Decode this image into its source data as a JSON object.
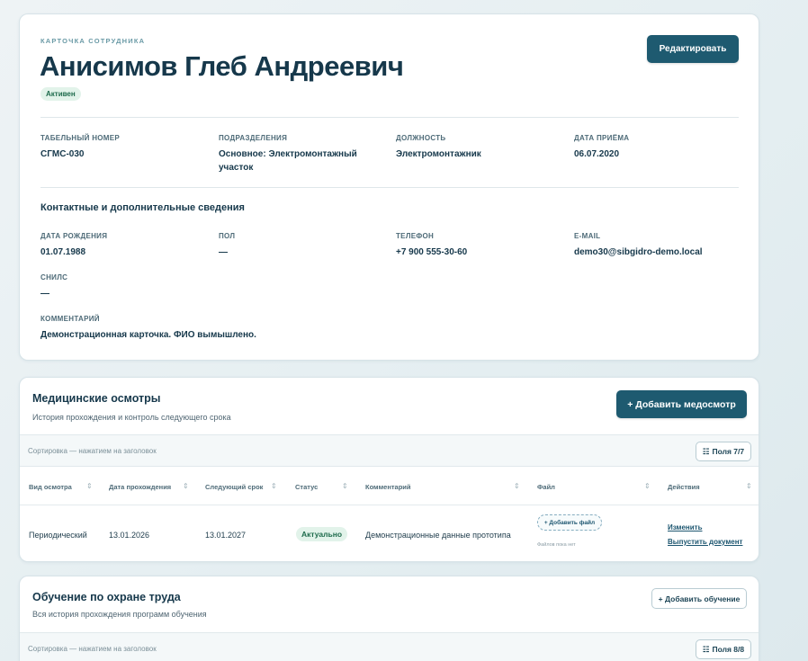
{
  "employee": {
    "eyebrow": "КАРТОЧКА СОТРУДНИКА",
    "name": "Анисимов Глеб Андреевич",
    "status": "Активен",
    "edit_label": "Редактировать",
    "fields": {
      "tab_number": {
        "label": "ТАБЕЛЬНЫЙ НОМЕР",
        "value": "СГМС-030"
      },
      "division": {
        "label": "ПОДРАЗДЕЛЕНИЯ",
        "value": "Основное: Электромонтажный участок"
      },
      "position": {
        "label": "ДОЛЖНОСТЬ",
        "value": "Электромонтажник"
      },
      "hire_date": {
        "label": "ДАТА ПРИЁМА",
        "value": "06.07.2020"
      }
    },
    "contacts_title": "Контактные и дополнительные сведения",
    "contacts": {
      "birth_date": {
        "label": "ДАТА РОЖДЕНИЯ",
        "value": "01.07.1988"
      },
      "gender": {
        "label": "ПОЛ",
        "value": "—"
      },
      "phone": {
        "label": "ТЕЛЕФОН",
        "value": "+7 900 555-30-60"
      },
      "email": {
        "label": "E-MAIL",
        "value": "demo30@sibgidro-demo.local"
      },
      "snils": {
        "label": "СНИЛС",
        "value": "—"
      },
      "comment": {
        "label": "КОММЕНТАРИЙ",
        "value": "Демонстрационная карточка. ФИО вымышлено."
      }
    }
  },
  "medical": {
    "title": "Медицинские осмотры",
    "subtitle": "История прохождения и контроль следующего срока",
    "add_label": "+ Добавить медосмотр",
    "sort_hint": "Сортировка — нажатием на заголовок",
    "fields_label": "Поля 7/7",
    "columns": [
      "Вид осмотра",
      "Дата прохождения",
      "Следующий срок",
      "Статус",
      "Комментарий",
      "Файл",
      "Действия"
    ],
    "rows": [
      {
        "type": "Периодический",
        "date": "13.01.2026",
        "next": "13.01.2027",
        "status": "Актуально",
        "comment": "Демонстрационные данные прототипа",
        "add_file": "+ Добавить файл",
        "no_files": "Файлов пока нет",
        "edit": "Изменить",
        "issue": "Выпустить документ"
      }
    ]
  },
  "training": {
    "title": "Обучение по охране труда",
    "subtitle": "Вся история прохождения программ обучения",
    "add_label": "+ Добавить обучение",
    "sort_hint": "Сортировка — нажатием на заголовок",
    "fields_label": "Поля 8/8"
  },
  "colors": {
    "primary": "#1e5a70",
    "status_ok_bg": "#e2f3ea",
    "status_ok_text": "#1e6b4c"
  }
}
